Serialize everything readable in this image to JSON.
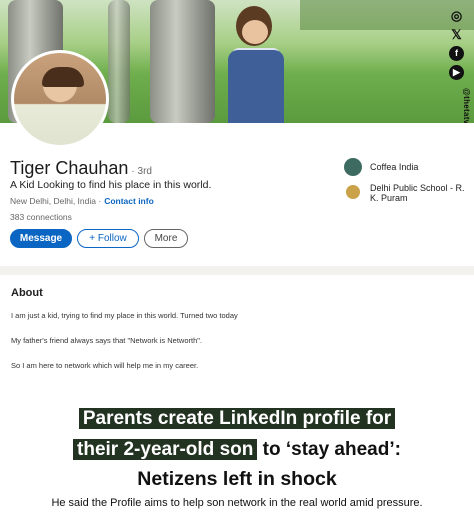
{
  "social": {
    "icons": [
      "instagram-icon",
      "x-icon",
      "facebook-icon",
      "youtube-icon"
    ],
    "handle": "@thetatvaindia"
  },
  "profile": {
    "name": "Tiger Chauhan",
    "degree": "· 3rd",
    "headline": "A Kid Looking to find his place in this world.",
    "location": "New Delhi, Delhi, India ·",
    "contact_link": "Contact info",
    "connections": "383 connections",
    "buttons": {
      "message": "Message",
      "follow": "+ Follow",
      "more": "More"
    },
    "orgs": [
      {
        "name": "Coffea India",
        "logo": "coffea-logo"
      },
      {
        "name": "Delhi Public School - R. K. Puram",
        "logo": "dps-logo"
      }
    ]
  },
  "about": {
    "title": "About",
    "lines": [
      "I am just a kid, trying to find my place in this world. Turned two today",
      "My father's friend always says that \"Network is Networth\".",
      "So I am here to network which will help me in my career."
    ]
  },
  "caption": {
    "line1": "Parents create LinkedIn profile for",
    "line2_highlight": "their 2-year-old son",
    "line2_rest": " to ‘stay ahead’:",
    "line3": "Netizens left in shock",
    "sub": "He said the Profile aims to help son network in the real world amid pressure."
  },
  "colors": {
    "linkedin_blue": "#0a66c2",
    "caption_highlight": "#233322"
  }
}
